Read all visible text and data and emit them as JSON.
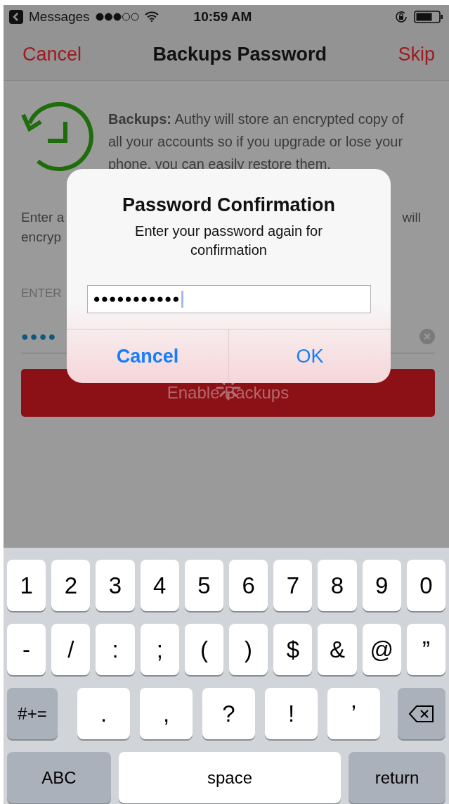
{
  "status_bar": {
    "back_app": "Messages",
    "time": "10:59 AM"
  },
  "nav": {
    "cancel": "Cancel",
    "title": "Backups Password",
    "skip": "Skip"
  },
  "intro": "**Backups:** Authy will store an encrypted copy of all your accounts so if you upgrade or lose your phone, you can easily restore them.",
  "hint": {
    "left_lines": [
      "Enter a",
      "encryp"
    ],
    "right": "will"
  },
  "password_field": {
    "label": "ENTER",
    "value": "●●●●"
  },
  "enable_button": "Enable Backups",
  "dialog": {
    "title": "Password Confirmation",
    "message": "Enter your password again for confirmation",
    "value": "●●●●●●●●●●●",
    "buttons": [
      {
        "label": "Cancel",
        "kind": "cancel"
      },
      {
        "label": "OK",
        "kind": "default"
      }
    ]
  },
  "keyboard": {
    "rows": [
      [
        {
          "label": "1",
          "kind": "char"
        },
        {
          "label": "2",
          "kind": "char"
        },
        {
          "label": "3",
          "kind": "char"
        },
        {
          "label": "4",
          "kind": "char"
        },
        {
          "label": "5",
          "kind": "char"
        },
        {
          "label": "6",
          "kind": "char"
        },
        {
          "label": "7",
          "kind": "char"
        },
        {
          "label": "8",
          "kind": "char"
        },
        {
          "label": "9",
          "kind": "char"
        },
        {
          "label": "0",
          "kind": "char"
        }
      ],
      [
        {
          "label": "-",
          "kind": "char"
        },
        {
          "label": "/",
          "kind": "char"
        },
        {
          "label": ":",
          "kind": "char"
        },
        {
          "label": ";",
          "kind": "char"
        },
        {
          "label": "(",
          "kind": "char"
        },
        {
          "label": ")",
          "kind": "char"
        },
        {
          "label": "$",
          "kind": "char"
        },
        {
          "label": "&",
          "kind": "char"
        },
        {
          "label": "@",
          "kind": "char"
        },
        {
          "label": "”",
          "kind": "char"
        }
      ]
    ],
    "punctuation_row": {
      "mode": "#+=",
      "keys": [
        ".",
        ",",
        "?",
        "!",
        "’"
      ]
    },
    "bottom_row": {
      "abc": "ABC",
      "space": "space",
      "return": "return"
    }
  }
}
